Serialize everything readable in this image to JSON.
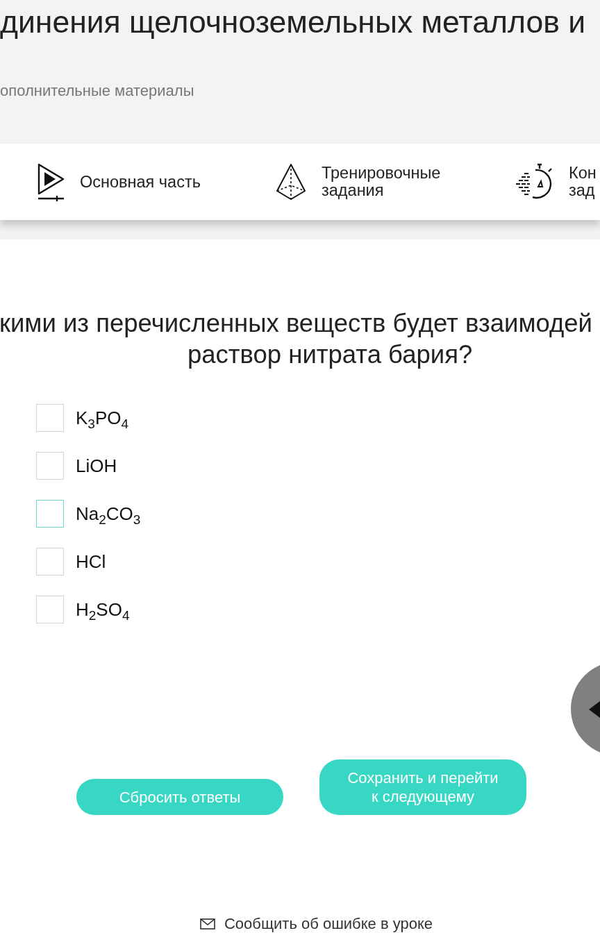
{
  "header": {
    "title": "динения щелочноземельных металлов и",
    "subtitle": "ополнительные материалы"
  },
  "tabs": [
    {
      "kind": "video",
      "lines": [
        "Основная часть"
      ]
    },
    {
      "kind": "training",
      "lines": [
        "Тренировочные",
        "задания"
      ]
    },
    {
      "kind": "control",
      "lines": [
        "Кон",
        "зад"
      ]
    }
  ],
  "question": {
    "lines": [
      "кими из перечисленных веществ будет взаимодей",
      "раствор нитрата бария?"
    ]
  },
  "options": [
    {
      "label": "K$_{3}$PO$_{4}$",
      "checked": false,
      "focused": false
    },
    {
      "label": "LiOH",
      "checked": false,
      "focused": false
    },
    {
      "label": "Na$_{2}$CO$_{3}$",
      "checked": false,
      "focused": true
    },
    {
      "label": "HCl",
      "checked": false,
      "focused": false
    },
    {
      "label": "H$_{2}$SO$_{4}$",
      "checked": false,
      "focused": false
    }
  ],
  "buttons": [
    {
      "lines": [
        "Сбросить ответы"
      ]
    },
    {
      "lines": [
        "Сохранить и перейти",
        "к следующему"
      ]
    }
  ],
  "report_link": {
    "label": "Сообщить об ошибке в уроке"
  }
}
